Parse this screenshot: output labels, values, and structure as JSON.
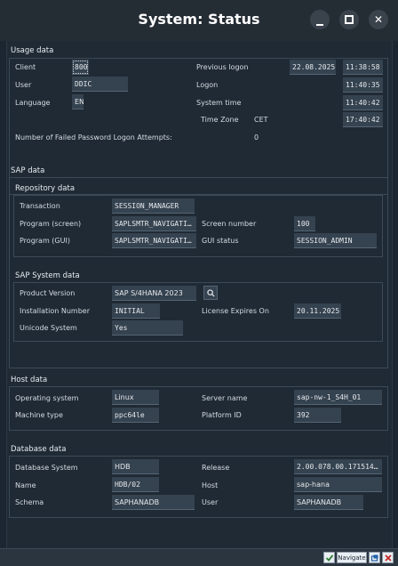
{
  "window": {
    "title": "System: Status",
    "minimize_icon": "minimize-icon",
    "maximize_icon": "maximize-icon",
    "close_icon": "close-icon"
  },
  "usage": {
    "heading": "Usage data",
    "client_label": "Client",
    "client_value": "800",
    "user_label": "User",
    "user_value": "DDIC",
    "language_label": "Language",
    "language_value": "EN",
    "prev_logon_label": "Previous logon",
    "prev_logon_date": "22.08.2025",
    "prev_logon_time": "11:38:58",
    "logon_label": "Logon",
    "logon_time": "11:40:35",
    "system_time_label": "System time",
    "system_time": "11:40:42",
    "timezone_label": "Time Zone",
    "timezone_value": "CET",
    "timezone_time": "17:40:42",
    "failed_label": "Number of Failed Password Logon Attempts:",
    "failed_value": "0"
  },
  "sap": {
    "heading": "SAP data",
    "repo_heading": "Repository data",
    "transaction_label": "Transaction",
    "transaction_value": "SESSION_MANAGER",
    "program_screen_label": "Program (screen)",
    "program_screen_value": "SAPLSMTR_NAVIGATI…",
    "program_gui_label": "Program (GUI)",
    "program_gui_value": "SAPLSMTR_NAVIGATI…",
    "screen_number_label": "Screen number",
    "screen_number_value": "100",
    "gui_status_label": "GUI status",
    "gui_status_value": "SESSION_ADMIN",
    "system_heading": "SAP System data",
    "product_version_label": "Product Version",
    "product_version_value": "SAP S/4HANA 2023",
    "details_icon": "search-icon",
    "installation_label": "Installation Number",
    "installation_value": "INITIAL",
    "license_label": "License Expires On",
    "license_value": "20.11.2025",
    "unicode_label": "Unicode System",
    "unicode_value": "Yes"
  },
  "host": {
    "heading": "Host data",
    "os_label": "Operating system",
    "os_value": "Linux",
    "machine_label": "Machine type",
    "machine_value": "ppc64le",
    "server_label": "Server name",
    "server_value": "sap-nw-1_S4H_01",
    "platform_label": "Platform ID",
    "platform_value": "392"
  },
  "db": {
    "heading": "Database data",
    "system_label": "Database System",
    "system_value": "HDB",
    "name_label": "Name",
    "name_value": "HDB/02",
    "schema_label": "Schema",
    "schema_value": "SAPHANADB",
    "release_label": "Release",
    "release_value": "2.00.078.00.171514…",
    "host_label": "Host",
    "host_value": "sap-hana",
    "user_label": "User",
    "user_value": "SAPHANADB"
  },
  "statusbar": {
    "confirm_icon": "checkmark-icon",
    "navigate_label": "Navigate",
    "restore_icon": "window-icon",
    "close_icon": "close-icon"
  },
  "colors": {
    "background": "#1f2a35",
    "field": "#35424f",
    "confirm": "#2e7d32",
    "close": "#c62828"
  }
}
